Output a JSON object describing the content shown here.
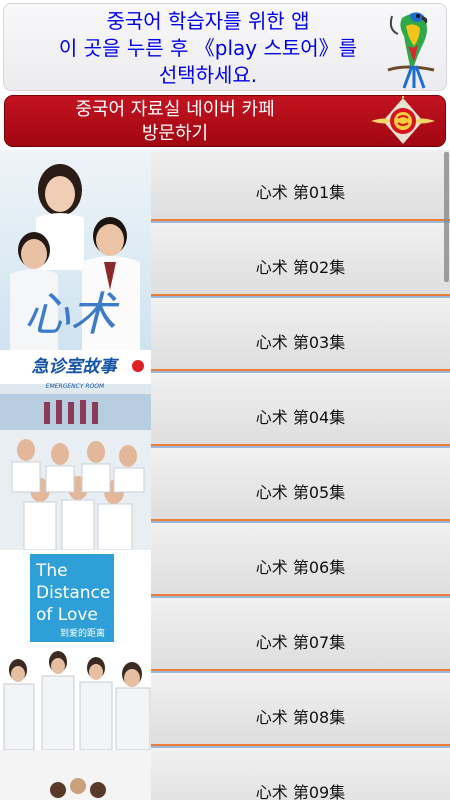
{
  "top_banner": {
    "line1": "중국어 학습자를 위한 앱",
    "line2": "이 곳을 누른 후 《play 스토어》를",
    "line3": "선택하세요.",
    "text_color": "#0000ee",
    "icon": "parrot-icon"
  },
  "cafe_banner": {
    "line1": "중국어 자료실 네이버 카페",
    "line2": "방문하기",
    "bg_color": "#b50e1a",
    "icon": "lantern-icon"
  },
  "posters": {
    "poster1": {
      "title_art": "心术"
    },
    "poster2": {
      "title": "急诊室故事",
      "subtitle": "EMERGENCY ROOM"
    },
    "poster3": {
      "title_line1": "The",
      "title_line2": "Distance",
      "title_line3": "of Love",
      "subtitle": "到爱的距离"
    }
  },
  "episodes": [
    {
      "label": "心术 第01集"
    },
    {
      "label": "心术 第02集"
    },
    {
      "label": "心术 第03集"
    },
    {
      "label": "心术 第04集"
    },
    {
      "label": "心术 第05集"
    },
    {
      "label": "心术 第06集"
    },
    {
      "label": "心术 第07集"
    },
    {
      "label": "心术 第08集"
    },
    {
      "label": "心术 第09集"
    }
  ]
}
